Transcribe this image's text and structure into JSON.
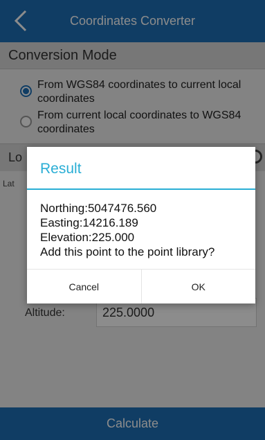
{
  "appbar": {
    "title": "Coordinates Converter"
  },
  "conversion_mode": {
    "header": "Conversion Mode",
    "options": [
      {
        "label": "From WGS84 coordinates to current local coordinates",
        "selected": true
      },
      {
        "label": "From current local coordinates to WGS84 coordinates",
        "selected": false
      }
    ]
  },
  "fragments": {
    "section_fragment": "Lo",
    "lat_fragment": "Lat"
  },
  "altitude": {
    "label": "Altitude:",
    "value": "225.0000"
  },
  "calculate_label": "Calculate",
  "dialog": {
    "title": "Result",
    "lines": [
      "Northing:5047476.560",
      "Easting:14216.189",
      "Elevation:225.000",
      "Add this point to the point library?"
    ],
    "cancel_label": "Cancel",
    "ok_label": "OK"
  },
  "colors": {
    "primary": "#1e6fb6",
    "dialog_accent": "#2aaed5"
  }
}
